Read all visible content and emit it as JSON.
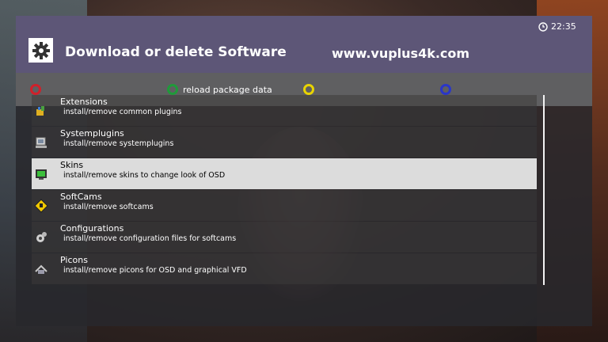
{
  "header": {
    "title": "Download or delete Software",
    "website": "www.vuplus4k.com",
    "clock": "22:35"
  },
  "buttons": {
    "red": {
      "label": "",
      "color": "#d0202a"
    },
    "green": {
      "label": "reload package data",
      "color": "#1f9a3a"
    },
    "yellow": {
      "label": "",
      "color": "#e8d300"
    },
    "blue": {
      "label": "",
      "color": "#2a36c8"
    }
  },
  "list": {
    "selected_index": 2,
    "items": [
      {
        "name": "Extensions",
        "description": "install/remove common plugins",
        "icon": "extensions-icon"
      },
      {
        "name": "Systemplugins",
        "description": "install/remove systemplugins",
        "icon": "systemplugins-icon"
      },
      {
        "name": "Skins",
        "description": "install/remove skins to change look of OSD",
        "icon": "skins-icon"
      },
      {
        "name": "SoftCams",
        "description": "install/remove softcams",
        "icon": "softcams-icon"
      },
      {
        "name": "Configurations",
        "description": "install/remove configuration files for softcams",
        "icon": "configurations-icon"
      },
      {
        "name": "Picons",
        "description": "install/remove picons for OSD and graphical VFD",
        "icon": "picons-icon"
      }
    ]
  }
}
